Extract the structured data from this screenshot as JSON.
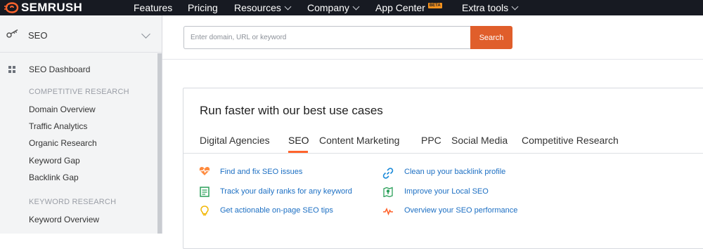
{
  "topbar": {
    "brand": "SEMRUSH",
    "nav": [
      {
        "label": "Features"
      },
      {
        "label": "Pricing"
      },
      {
        "label": "Resources"
      },
      {
        "label": "Company"
      },
      {
        "label": "App Center",
        "badge": "BETA"
      },
      {
        "label": "Extra tools"
      }
    ]
  },
  "sidebar": {
    "toolkit_label": "SEO",
    "dashboard_label": "SEO Dashboard",
    "sections": [
      {
        "title": "COMPETITIVE RESEARCH",
        "items": [
          "Domain Overview",
          "Traffic Analytics",
          "Organic Research",
          "Keyword Gap",
          "Backlink Gap"
        ]
      },
      {
        "title": "KEYWORD RESEARCH",
        "items": [
          "Keyword Overview"
        ]
      }
    ]
  },
  "search": {
    "placeholder": "Enter domain, URL or keyword",
    "button_label": "Search"
  },
  "card": {
    "title": "Run faster with our best use cases",
    "tabs": [
      "Digital Agencies",
      "SEO",
      "Content Marketing",
      "PPC",
      "Social Media",
      "Competitive Research"
    ],
    "active_tab": "SEO",
    "use_cases_left": [
      {
        "label": "Find and fix SEO issues",
        "icon": "heart-pulse-icon"
      },
      {
        "label": "Track your daily ranks for any keyword",
        "icon": "ranking-doc-icon"
      },
      {
        "label": "Get actionable on-page SEO tips",
        "icon": "lightbulb-icon"
      }
    ],
    "use_cases_right": [
      {
        "label": "Clean up your backlink profile",
        "icon": "link-icon"
      },
      {
        "label": "Improve your Local SEO",
        "icon": "map-pin-icon"
      },
      {
        "label": "Overview your SEO performance",
        "icon": "pulse-line-icon"
      }
    ]
  },
  "colors": {
    "topbar_bg": "#171a22",
    "accent_orange": "#e05e2b",
    "link_blue": "#1c6fc3",
    "sidebar_bg": "#f3f4f5"
  }
}
